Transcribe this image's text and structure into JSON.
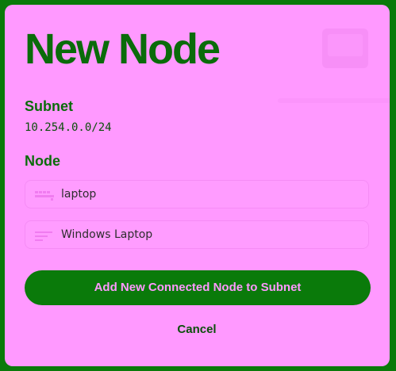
{
  "dialog": {
    "title": "New Node",
    "subnet": {
      "label": "Subnet",
      "value": "10.254.0.0/24"
    },
    "node": {
      "label": "Node",
      "hostname_value": "laptop",
      "description_value": "Windows Laptop"
    },
    "primary_button_label": "Add New Connected Node to Subnet",
    "cancel_label": "Cancel"
  },
  "colors": {
    "background": "#0a7a0a",
    "dialog": "#ff99ff",
    "text": "#0a6b0a",
    "button": "#0a7a0a"
  },
  "icons": {
    "decoration": "monitor-icon",
    "hostname_field": "server-icon",
    "description_field": "lines-icon"
  }
}
